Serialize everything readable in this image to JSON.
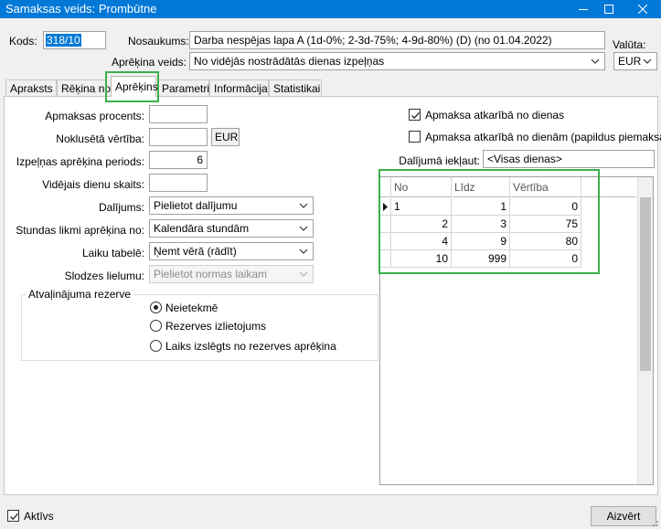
{
  "window": {
    "title": "Samaksas veids: Prombūtne"
  },
  "header": {
    "kods_label": "Kods:",
    "kods_value": "318/10",
    "nosaukums_label": "Nosaukums:",
    "nosaukums_value": "Darba nespējas lapa A (1d-0%; 2-3d-75%; 4-9d-80%) (D) (no 01.04.2022)",
    "aprekina_veids_label": "Aprēķina veids:",
    "aprekina_veids_value": "No vidējās nostrādātās dienas izpeļņas",
    "valuta_label": "Valūta:",
    "valuta_value": "EUR"
  },
  "tabs": [
    {
      "label": "Apraksts"
    },
    {
      "label": "Rēķina no"
    },
    {
      "label": "Aprēķins"
    },
    {
      "label": "Parametri"
    },
    {
      "label": "Informācija"
    },
    {
      "label": "Statistikai"
    }
  ],
  "form": {
    "apmaksas_procents_label": "Apmaksas procents:",
    "apmaksas_procents_value": "",
    "nokluseta_vertiba_label": "Noklusētā vērtība:",
    "nokluseta_vertiba_value": "",
    "nokluseta_vertiba_currency": "EUR",
    "izpelnas_periods_label": "Izpeļņas aprēķina periods:",
    "izpelnas_periods_value": "6",
    "videjais_dienu_label": "Vidējais dienu skaits:",
    "videjais_dienu_value": "",
    "dalijums_label": "Dalījums:",
    "dalijums_value": "Pielietot dalījumu",
    "stundas_likmi_label": "Stundas likmi aprēķina no:",
    "stundas_likmi_value": "Kalendāra stundām",
    "laiku_tabele_label": "Laiku tabelē:",
    "laiku_tabele_value": "Ņemt vērā (rādīt)",
    "slodzes_lielumu_label": "Slodzes lielumu:",
    "slodzes_lielumu_value": "Pielietot normas laikam"
  },
  "reserve": {
    "title": "Atvaļinājuma rezerve",
    "options": [
      {
        "label": "Neietekmē",
        "selected": true
      },
      {
        "label": "Rezerves izlietojums",
        "selected": false
      },
      {
        "label": "Laiks izslēgts no rezerves aprēķina",
        "selected": false
      }
    ]
  },
  "right": {
    "cb1_label": "Apmaksa atkarībā no dienas",
    "cb1_checked": true,
    "cb2_label": "Apmaksa atkarībā no dienām (papildus piemaksām)",
    "cb2_checked": false,
    "dalijuma_iekļaut_label": "Dalījumā iekļaut:",
    "dalijuma_iekļaut_value": "<Visas dienas>"
  },
  "grid": {
    "columns": [
      "No",
      "Līdz",
      "Vērtība"
    ],
    "rows": [
      [
        "1",
        "1",
        "0"
      ],
      [
        "2",
        "3",
        "75"
      ],
      [
        "4",
        "9",
        "80"
      ],
      [
        "10",
        "999",
        "0"
      ]
    ]
  },
  "footer": {
    "aktivs_label": "Aktīvs",
    "aktivs_checked": true,
    "close_label": "Aizvērt"
  },
  "icons": {
    "minimize": "minimize-icon",
    "maximize": "maximize-icon",
    "close": "close-icon",
    "dropdown": "chevron-down-icon",
    "check": "checkmark-icon",
    "row_indicator": "row-pointer-icon"
  }
}
